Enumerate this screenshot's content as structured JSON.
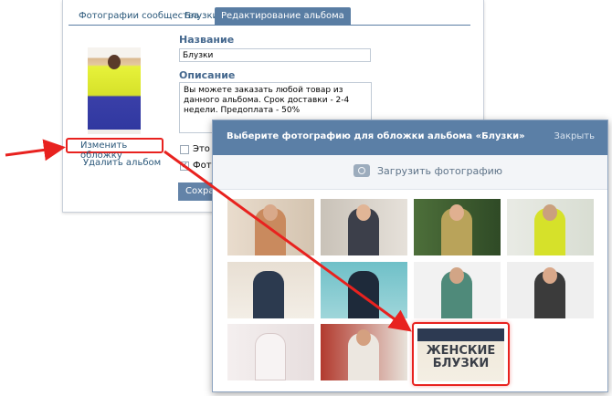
{
  "editor": {
    "tabs": [
      {
        "label": "Фотографии сообщества",
        "active": false
      },
      {
        "label": "Блузки",
        "active": false
      },
      {
        "label": "Редактирование альбома",
        "active": true
      }
    ],
    "name_label": "Название",
    "name_value": "Блузки",
    "description_label": "Описание",
    "description_value": "Вы можете заказать любой товар из данного альбома. Срок доставки - 2-4 недели. Предоплата - 50%",
    "change_cover_label": "Изменить обложку",
    "delete_album_label": "Удалить альбом",
    "checkbox1_label": "Это ос",
    "checkbox2_label": "Фотогр",
    "save_label": "Сохран"
  },
  "dialog": {
    "title": "Выберите фотографию для обложки альбома «Блузки»",
    "close_label": "Закрыть",
    "upload_label": "Загрузить фотографию",
    "highlighted_thumb_text": "ЖЕНСКИЕ БЛУЗКИ"
  },
  "colors": {
    "accent": "#597da3",
    "header": "#5b7fa6",
    "link": "#2b587a",
    "annotation_red": "#e8221f"
  }
}
